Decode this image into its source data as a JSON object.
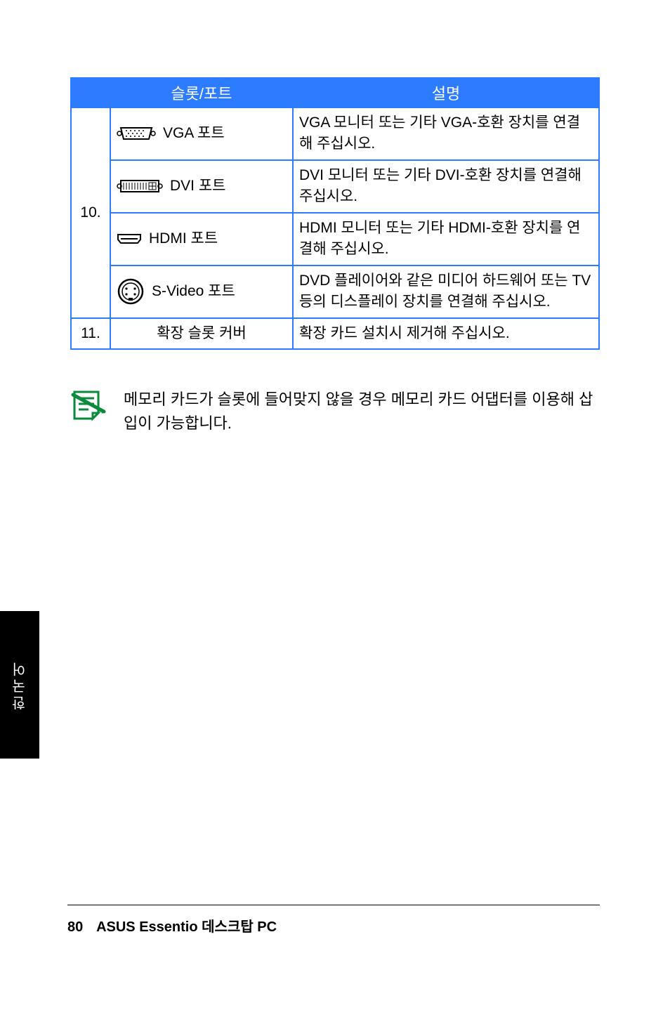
{
  "table": {
    "headers": {
      "num": "",
      "slot": "슬롯/포트",
      "desc": "설명"
    },
    "group_num": "10.",
    "rows": [
      {
        "icon": "vga",
        "name": "VGA 포트",
        "desc": "VGA 모니터 또는 기타 VGA-호환 장치를 연결해 주십시오."
      },
      {
        "icon": "dvi",
        "name": "DVI 포트",
        "desc": "DVI 모니터 또는 기타 DVI-호환 장치를 연결해 주십시오."
      },
      {
        "icon": "hdmi",
        "name": "HDMI 포트",
        "desc": "HDMI 모니터 또는 기타 HDMI-호환 장치를 연결해 주십시오."
      },
      {
        "icon": "svideo",
        "name": "S-Video 포트",
        "desc": "DVD 플레이어와 같은 미디어 하드웨어 또는 TV 등의 디스플레이 장치를 연결해 주십시오."
      }
    ],
    "row11": {
      "num": "11.",
      "name": "확장 슬롯 커버",
      "desc": "확장 카드 설치시 제거해 주십시오."
    }
  },
  "note": {
    "text": "메모리 카드가 슬롯에 들어맞지 않을 경우 메모리 카드 어댑터를 이용해 삽입이 가능합니다."
  },
  "side_tab": "한국어",
  "footer": {
    "page": "80",
    "title": "ASUS Essentio 데스크탑 PC"
  }
}
